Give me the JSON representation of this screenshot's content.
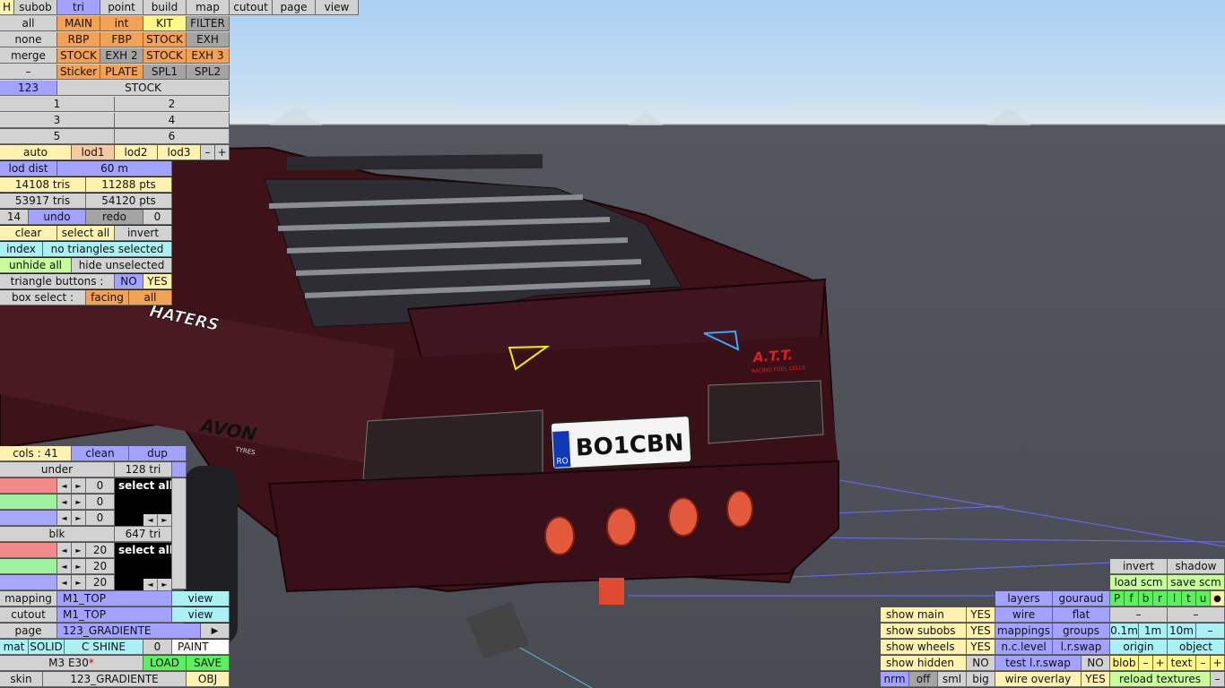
{
  "viewport": {
    "plate": "BO1CBN",
    "plate_country": "RO",
    "sticker_haters": "HATERS",
    "sticker_avon": "AVON",
    "sticker_avon_sub": "TYRES",
    "sticker_att": "A.T.T.",
    "sticker_att_sub": "RACING FUEL CELLS"
  },
  "top_tabs": [
    "H",
    "subob",
    "tri",
    "point",
    "build",
    "map",
    "cutout",
    "page",
    "view"
  ],
  "subobj": {
    "row1": [
      "all",
      "MAIN",
      "int",
      "KIT",
      "FILTER"
    ],
    "row2": [
      "none",
      "RBP",
      "FBP",
      "STOCK",
      "EXH"
    ],
    "row3": [
      "merge",
      "STOCK",
      "EXH 2",
      "STOCK",
      "EXH 3"
    ],
    "row4": [
      "–",
      "Sticker",
      "PLATE",
      "SPL1",
      "SPL2"
    ],
    "row5": [
      "123",
      "STOCK"
    ],
    "pairs": [
      [
        "1",
        "2"
      ],
      [
        "3",
        "4"
      ],
      [
        "5",
        "6"
      ]
    ]
  },
  "lod": {
    "buttons": [
      "auto",
      "lod1",
      "lod2",
      "lod3",
      "–",
      "+"
    ],
    "dist_label": "lod dist",
    "dist_value": "60 m"
  },
  "stats": {
    "tris_a": "14108 tris",
    "pts_a": "11288 pts",
    "tris_b": "53917 tris",
    "pts_b": "54120 pts"
  },
  "undo": {
    "count": "14",
    "undo": "undo",
    "redo": "redo",
    "redo_count": "0"
  },
  "select": {
    "clear": "clear",
    "select_all": "select all",
    "invert": "invert",
    "index": "index",
    "status": "no triangles selected",
    "unhide_all": "unhide all",
    "hide_unselected": "hide unselected",
    "triangle_buttons": "triangle buttons :",
    "no": "NO",
    "yes": "YES",
    "box_select": "box select :",
    "facing": "facing",
    "all": "all"
  },
  "cols": {
    "label": "cols : 41",
    "clean": "clean",
    "dup": "dup"
  },
  "colors": [
    {
      "name": "under",
      "count": "128 tri",
      "values": [
        "0",
        "0",
        "0"
      ],
      "select_all": "select all"
    },
    {
      "name": "blk",
      "count": "647 tri",
      "values": [
        "20",
        "20",
        "20"
      ],
      "select_all": "select all"
    }
  ],
  "icons": {
    "left_arrow": "◄",
    "right_arrow": "►",
    "play": "▶",
    "dot": "●"
  },
  "material": {
    "mapping_label": "mapping",
    "mapping_value": "M1_TOP",
    "mapping_view": "view",
    "cutout_label": "cutout",
    "cutout_value": "M1_TOP",
    "cutout_view": "view",
    "page_label": "page",
    "page_value": "123_GRADIENTE",
    "mat": "mat",
    "solid": "SOLID",
    "cshine": "C SHINE",
    "zero": "0",
    "paint": "PAINT",
    "car": "M3 E30",
    "modified": "*",
    "load": "LOAD",
    "save": "SAVE",
    "skin_label": "skin",
    "skin_value": "123_GRADIENTE",
    "obj": "OBJ"
  },
  "display": {
    "show_main": "show main",
    "show_subobs": "show subobs",
    "show_wheels": "show wheels",
    "show_hidden": "show hidden",
    "yes": "YES",
    "no": "NO",
    "nrm": "nrm",
    "off": "off",
    "sml": "sml",
    "big": "big",
    "layers": "layers",
    "gouraud": "gouraud",
    "wire": "wire",
    "flat": "flat",
    "mappings": "mappings",
    "groups": "groups",
    "nclevel": "n.c.level",
    "lrswap": "l.r.swap",
    "test_lrswap": "test l.r.swap",
    "wire_overlay": "wire overlay",
    "invert": "invert",
    "shadow": "shadow",
    "load_scm": "load scm",
    "save_scm": "save scm",
    "flags": [
      "P",
      "f",
      "b",
      "r",
      "l",
      "t",
      "u"
    ],
    "minus": "–",
    "dist": [
      "0.1m",
      "1m",
      "10m"
    ],
    "origin": "origin",
    "object": "object",
    "blob": "blob",
    "text": "text",
    "reload": "reload textures",
    "plus": "+"
  }
}
